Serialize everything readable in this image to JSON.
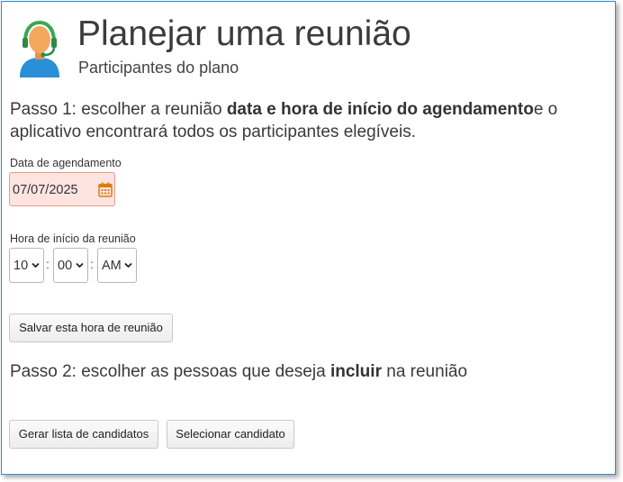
{
  "header": {
    "title": "Planejar uma reunião",
    "subtitle": "Participantes do plano"
  },
  "step1": {
    "prefix": "Passo 1: escolher a reunião ",
    "bold": "data e hora de início do agendamento",
    "suffix": "e o aplicativo encontrará todos os participantes elegíveis."
  },
  "schedule_date": {
    "label": "Data de agendamento",
    "value": "07/07/2025"
  },
  "start_time": {
    "label": "Hora de início da reunião",
    "hour": "10",
    "minute": "00",
    "ampm": "AM",
    "separator": ":"
  },
  "buttons": {
    "save": "Salvar esta hora de reunião",
    "generate": "Gerar lista de candidatos",
    "select": "Selecionar candidato"
  },
  "step2": {
    "prefix": "Passo 2: escolher as pessoas que deseja ",
    "bold": "incluir",
    "suffix": " na reunião"
  },
  "icons": {
    "avatar": "support-agent-headset-icon",
    "calendar": "calendar-icon",
    "dropdown": "chevron-down-icon"
  },
  "colors": {
    "frame_border": "#2a8fd6",
    "date_invalid_bg": "#fde4e1",
    "date_invalid_border": "#e89a8f",
    "calendar_icon": "#e07a12",
    "avatar_shirt": "#2a8fd6",
    "avatar_skin": "#f4a85e",
    "headset": "#3aa655"
  }
}
